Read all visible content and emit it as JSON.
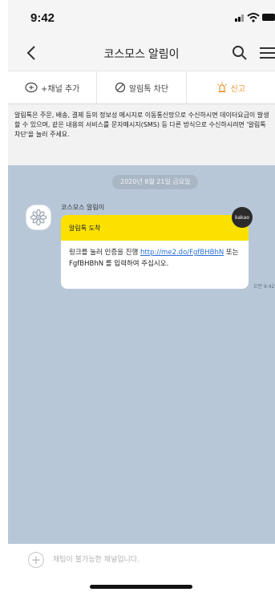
{
  "status_bar": {
    "time": "9:42",
    "icons": [
      "signal-icon",
      "wifi-icon",
      "battery-icon"
    ]
  },
  "nav": {
    "title": "코스모스 알림이",
    "icons": [
      "back-arrow-icon",
      "search-icon",
      "menu-icon"
    ]
  },
  "actions": [
    {
      "icon": "add-channel-icon",
      "label": "+채널 추가"
    },
    {
      "icon": "block-icon",
      "label": "알림톡 차단"
    },
    {
      "icon": "siren-icon",
      "label": "신고"
    }
  ],
  "notice": {
    "text": "알림톡은 주문, 배송, 결제 등의 정보성 메시지로 이동통신망으로 수신하시면 데이터요금이 발생할 수 있으며, 같은 내용의 서비스를 문자메시지(SMS) 등 다른 방식으로 수신하시려면 '알림톡 차단'을 눌러 주세요."
  },
  "chat": {
    "date": "2020년 8월 21일 금요일",
    "sender": "코스모스 알림이",
    "message_title": "알림톡 도착",
    "message_prefix": "링크를 눌러 인증을 진행 ",
    "link": "http://me2.do/FgfBHBhN",
    "message_suffix": " 또는 FgfBHBhN 를 입력하여 주십시오.",
    "badge": "kakao",
    "time": "오전 9:42"
  },
  "input": {
    "placeholder": "채팅이 불가능한 채널입니다."
  },
  "colors": {
    "chat_background": "#b8c7d8",
    "message_header": "#fae100",
    "link": "#2a6fd6",
    "report": "#e8902a"
  }
}
